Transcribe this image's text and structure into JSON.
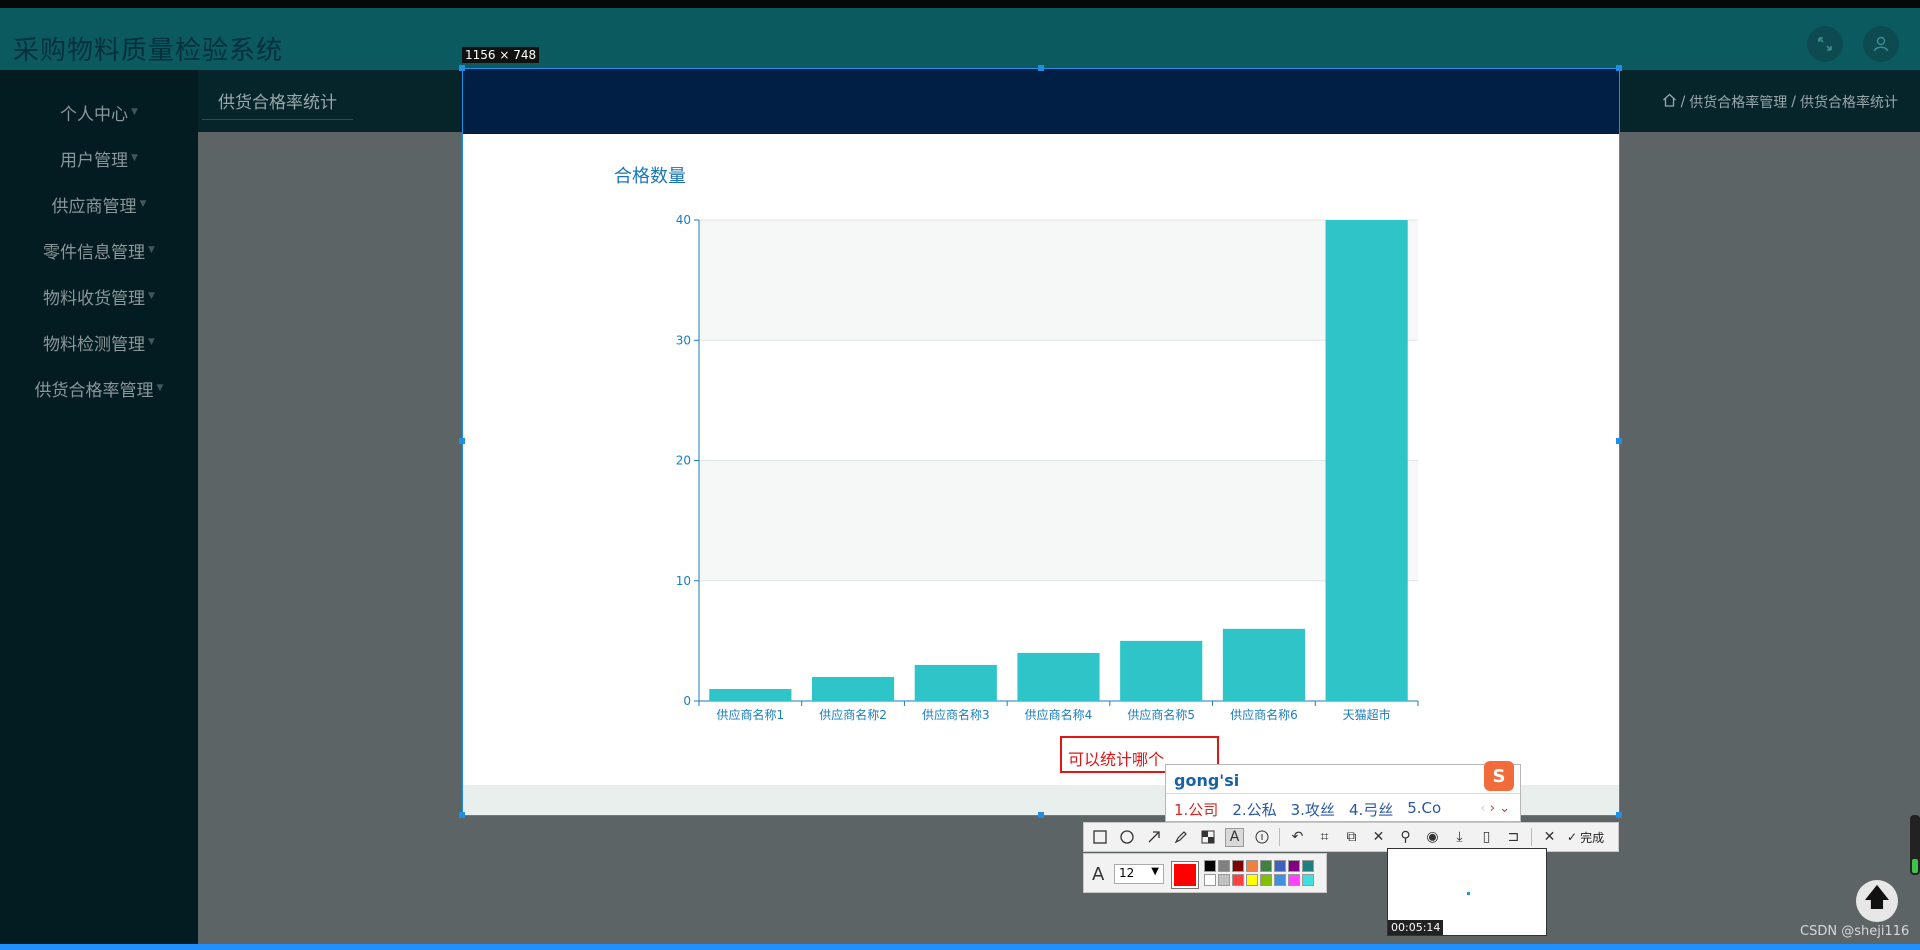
{
  "app": {
    "title": "采购物料质量检验系统"
  },
  "header_icons": [
    "fullscreen-icon",
    "user-icon"
  ],
  "sidebar": {
    "items": [
      {
        "label": "个人中心"
      },
      {
        "label": "用户管理"
      },
      {
        "label": "供应商管理"
      },
      {
        "label": "零件信息管理"
      },
      {
        "label": "物料收货管理"
      },
      {
        "label": "物料检测管理"
      },
      {
        "label": "供货合格率管理"
      }
    ]
  },
  "tabs": [
    {
      "label": "供货合格率统计"
    }
  ],
  "breadcrumb": {
    "sep": "/",
    "items": [
      "供货合格率管理",
      "供货合格率统计"
    ]
  },
  "selection": {
    "dims": "1156 × 748"
  },
  "chart_data": {
    "type": "bar",
    "title": "合格数量",
    "categories": [
      "供应商名称1",
      "供应商名称2",
      "供应商名称3",
      "供应商名称4",
      "供应商名称5",
      "供应商名称6",
      "天猫超市"
    ],
    "values": [
      1,
      2,
      3,
      4,
      5,
      6,
      40
    ],
    "ylim": [
      0,
      40
    ],
    "yticks": [
      0,
      10,
      20,
      30,
      40
    ],
    "bar_color": "#2fc4c8",
    "axis_color": "#1a7ec0"
  },
  "annotation": {
    "text": "可以统计哪个"
  },
  "ime": {
    "input": "gong'si",
    "candidates": [
      "1.公司",
      "2.公私",
      "3.攻丝",
      "4.弓丝",
      "5.Co"
    ],
    "logo": "S"
  },
  "toolbar": {
    "done_label": "完成",
    "font_size": "12",
    "current_color": "#ff0000",
    "palette": [
      "#000000",
      "#808080",
      "#800000",
      "#f08040",
      "#408040",
      "#4060c0",
      "#800080",
      "#208080",
      "#ffffff",
      "#c0c0c0",
      "#ff4040",
      "#ffff00",
      "#80c000",
      "#4090e0",
      "#ff40ff",
      "#40e0e0"
    ]
  },
  "preview": {
    "time": "00:05:14"
  },
  "watermark": "CSDN @sheji116"
}
